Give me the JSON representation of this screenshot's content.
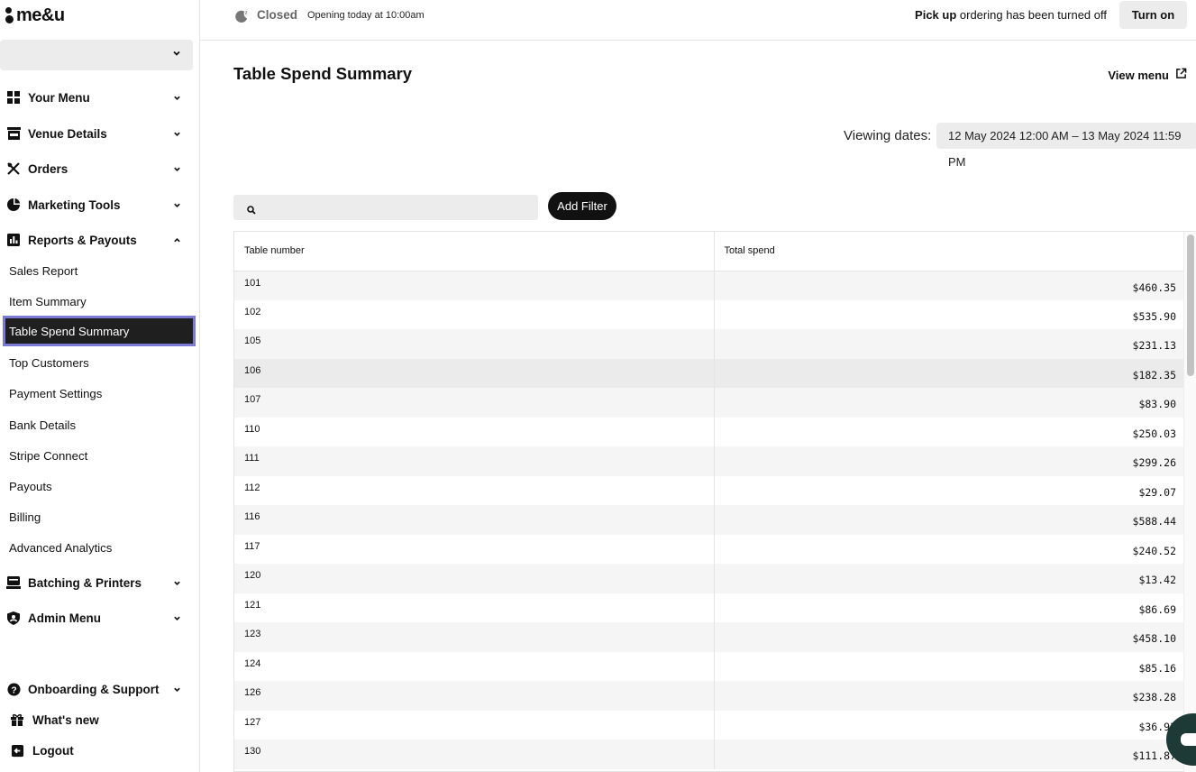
{
  "brand": {
    "logo_text": "me&u"
  },
  "sidebar": {
    "venue_value": "",
    "sections": [
      {
        "label": "Your Menu",
        "icon": "grid-icon"
      },
      {
        "label": "Venue Details",
        "icon": "storefront-icon"
      },
      {
        "label": "Orders",
        "icon": "utensils-icon"
      },
      {
        "label": "Marketing Tools",
        "icon": "pie-chart-icon"
      },
      {
        "label": "Reports & Payouts",
        "icon": "bar-chart-icon",
        "expanded": true
      },
      {
        "label": "Batching & Printers",
        "icon": "printer-icon"
      },
      {
        "label": "Admin Menu",
        "icon": "shield-user-icon"
      }
    ],
    "report_items": [
      "Sales Report",
      "Item Summary",
      "Table Spend Summary",
      "Top Customers",
      "Payment Settings",
      "Bank Details",
      "Stripe Connect",
      "Payouts",
      "Billing",
      "Advanced Analytics"
    ],
    "active_item": "Table Spend Summary",
    "bottom": {
      "support": "Onboarding & Support",
      "whats_new": "What's new",
      "logout": "Logout"
    }
  },
  "topbar": {
    "status": "Closed",
    "opening": "Opening today at 10:00am",
    "pickup_bold": "Pick up",
    "pickup_rest": " ordering has been turned off",
    "turn_on_label": "Turn on"
  },
  "main": {
    "title": "Table Spend Summary",
    "view_menu": "View menu",
    "viewing_label": "Viewing dates:",
    "date_range": "12 May 2024 12:00 AM – 13 May 2024 11:59 PM",
    "search_placeholder": "",
    "add_filter": "Add Filter"
  },
  "table": {
    "headers": [
      "Table number",
      "Total spend"
    ],
    "rows": [
      [
        "101",
        "$460.35"
      ],
      [
        "102",
        "$535.90"
      ],
      [
        "105",
        "$231.13"
      ],
      [
        "106",
        "$182.35"
      ],
      [
        "107",
        "$83.90"
      ],
      [
        "110",
        "$250.03"
      ],
      [
        "111",
        "$299.26"
      ],
      [
        "112",
        "$29.07"
      ],
      [
        "116",
        "$588.44"
      ],
      [
        "117",
        "$240.52"
      ],
      [
        "120",
        "$13.42"
      ],
      [
        "121",
        "$86.69"
      ],
      [
        "123",
        "$458.10"
      ],
      [
        "124",
        "$85.16"
      ],
      [
        "126",
        "$238.28"
      ],
      [
        "127",
        "$36.93"
      ],
      [
        "130",
        "$111.87"
      ]
    ]
  },
  "colors": {
    "active_border": "#7b7bd6",
    "active_bg": "#1f1f1f",
    "chat_bubble": "#1e3a36"
  }
}
